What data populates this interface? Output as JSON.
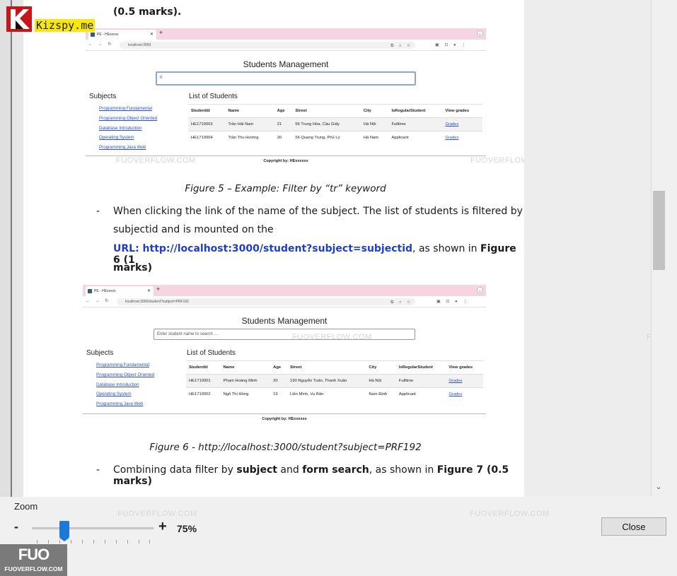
{
  "document": {
    "top_text": "(0.5 marks).",
    "figure5": {
      "tab_title": "PE - HExxxxx",
      "url": "localhost:3000",
      "app_title": "Students Management",
      "search_value": "tr",
      "subjects_heading": "Subjects",
      "subjects": [
        "Programming Fundamental",
        "Programming Object Oriented",
        "Database Introduction",
        "Operating System",
        "Programming Java Web"
      ],
      "list_heading": "List of Students",
      "columns": [
        "StudentId",
        "Name",
        "Age",
        "Street",
        "City",
        "IsRegularStudent",
        "View grades"
      ],
      "rows": [
        [
          "HE1710003",
          "Trần Hải Nam",
          "21",
          "56 Trung Hòa, Cầu Giấy",
          "Hà Nội",
          "Fulltime",
          "Grades"
        ],
        [
          "HE1710004",
          "Trần Thu Hường",
          "20",
          "56 Quang Trung, Phủ Lý",
          "Hà Nam",
          "Applicant",
          "Grades"
        ]
      ],
      "copyright": "Copyright by: HExxxxxx",
      "caption": "Figure 5 – Example: Filter by “tr” keyword"
    },
    "bullet1": {
      "line1": "When clicking the link of the name of the subject. The list of students is filtered by",
      "line2": "subjectid and is mounted on the",
      "url_text": "URL: http://localhost:3000/student?subject=subjectid",
      "after_url": ", as shown in ",
      "fig_ref": "Figure 6 (1",
      "line4": "marks)"
    },
    "figure6": {
      "tab_title": "PE - HExxxxx",
      "url": "localhost:3000/student?subject=PRF192",
      "app_title": "Students Management",
      "search_placeholder": "Enter student name to search ...",
      "subjects_heading": "Subjects",
      "subjects": [
        "Programming Fundamental",
        "Programming Object Oriented",
        "Database Introduction",
        "Operating System",
        "Programming Java Web"
      ],
      "list_heading": "List of Students",
      "columns": [
        "StudentId",
        "Name",
        "Age",
        "Street",
        "City",
        "IsRegularStudent",
        "View grades"
      ],
      "rows": [
        [
          "HE1710001",
          "Phạm Hoàng Minh",
          "20",
          "190 Nguyễn Tuân, Thanh Xuân",
          "Hà Nội",
          "Fulltime",
          "Grades"
        ],
        [
          "HE1710002",
          "Ngô Thị Hồng",
          "19",
          "Liên Minh, Vụ Bản",
          "Nam Định",
          "Applicant",
          "Grades"
        ]
      ],
      "copyright": "Copyright by: HExxxxxx",
      "caption": "Figure 6 - http://localhost:3000/student?subject=PRF192"
    },
    "bullet2": {
      "pre": "Combining data filter by ",
      "b1": "subject",
      "mid": " and ",
      "b2": "form search",
      "post": ", as shown in ",
      "b3": "Figure 7 (0.5 marks)"
    },
    "bullet_char": "-",
    "watermark": "FUOVERFLOW.COM"
  },
  "zoom": {
    "label": "Zoom",
    "minus": "-",
    "plus": "+",
    "value": "75%",
    "level_fraction": 0.27
  },
  "close_label": "Close",
  "logos": {
    "kizspy": "Kizspy.me",
    "fuo_mark": "FUO",
    "fuo_sub": "FUOVERFLOW.COM"
  },
  "icons": [
    "scroll-down-icon",
    "chevron-down-icon"
  ],
  "colors": {
    "accent": "#1a7ad6",
    "link": "#2a4fd0",
    "url_blue": "#1f3fbf",
    "tabbar": "#f6d4e2"
  }
}
